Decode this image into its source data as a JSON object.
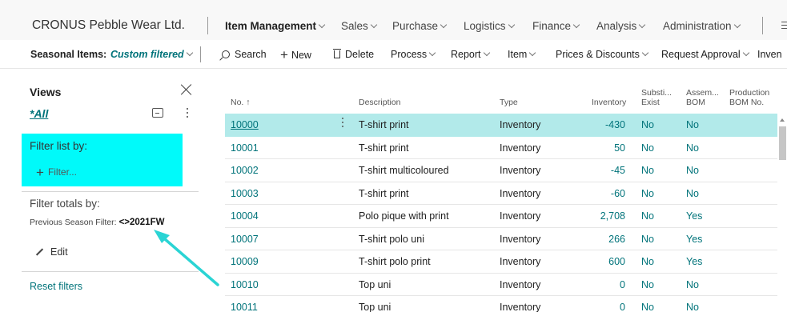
{
  "app": {
    "company": "CRONUS Pebble Wear Ltd.",
    "nav": [
      {
        "label": "Item Management",
        "active": true
      },
      {
        "label": "Sales",
        "active": false
      },
      {
        "label": "Purchase",
        "active": false
      },
      {
        "label": "Logistics",
        "active": false
      },
      {
        "label": "Finance",
        "active": false
      },
      {
        "label": "Analysis",
        "active": false
      },
      {
        "label": "Administration",
        "active": false
      }
    ]
  },
  "actionbar": {
    "page_title": "Seasonal Items:",
    "filter_state": "Custom filtered",
    "search": "Search",
    "new": "New",
    "delete": "Delete",
    "process": "Process",
    "report": "Report",
    "item": "Item",
    "prices_discounts": "Prices & Discounts",
    "request_approval": "Request Approval",
    "inventory_cut": "Inven"
  },
  "filter_pane": {
    "views_title": "Views",
    "view_all": "*All",
    "filter_list_by": "Filter list by:",
    "add_filter": "Filter...",
    "filter_totals_by": "Filter totals by:",
    "prev_season_label": "Previous Season Filter:",
    "prev_season_value": "<>2021FW",
    "edit": "Edit",
    "reset_filters": "Reset filters"
  },
  "colors": {
    "highlight": "#00fafa",
    "accent": "#00737a",
    "selected_row": "#b2eaea",
    "arrow": "#2ad4d4"
  },
  "grid": {
    "headers": {
      "no": "No. ↑",
      "description": "Description",
      "type": "Type",
      "inventory": "Inventory",
      "subst_1": "Substi...",
      "subst_2": "Exist",
      "asm_1": "Assem...",
      "asm_2": "BOM",
      "prod_1": "Production",
      "prod_2": "BOM No."
    },
    "rows": [
      {
        "no": "10000",
        "description": "T-shirt print",
        "type": "Inventory",
        "inventory": "-430",
        "subst": "No",
        "asm": "No"
      },
      {
        "no": "10001",
        "description": "T-shirt print",
        "type": "Inventory",
        "inventory": "50",
        "subst": "No",
        "asm": "No"
      },
      {
        "no": "10002",
        "description": "T-shirt multicoloured",
        "type": "Inventory",
        "inventory": "-45",
        "subst": "No",
        "asm": "No"
      },
      {
        "no": "10003",
        "description": "T-shirt print",
        "type": "Inventory",
        "inventory": "-60",
        "subst": "No",
        "asm": "No"
      },
      {
        "no": "10004",
        "description": "Polo pique with print",
        "type": "Inventory",
        "inventory": "2,708",
        "subst": "No",
        "asm": "Yes"
      },
      {
        "no": "10007",
        "description": "T-shirt polo uni",
        "type": "Inventory",
        "inventory": "266",
        "subst": "No",
        "asm": "Yes"
      },
      {
        "no": "10009",
        "description": "T-shirt polo print",
        "type": "Inventory",
        "inventory": "600",
        "subst": "No",
        "asm": "Yes"
      },
      {
        "no": "10010",
        "description": "Top uni",
        "type": "Inventory",
        "inventory": "0",
        "subst": "No",
        "asm": "No"
      },
      {
        "no": "10011",
        "description": "Top uni",
        "type": "Inventory",
        "inventory": "0",
        "subst": "No",
        "asm": "No"
      }
    ]
  }
}
